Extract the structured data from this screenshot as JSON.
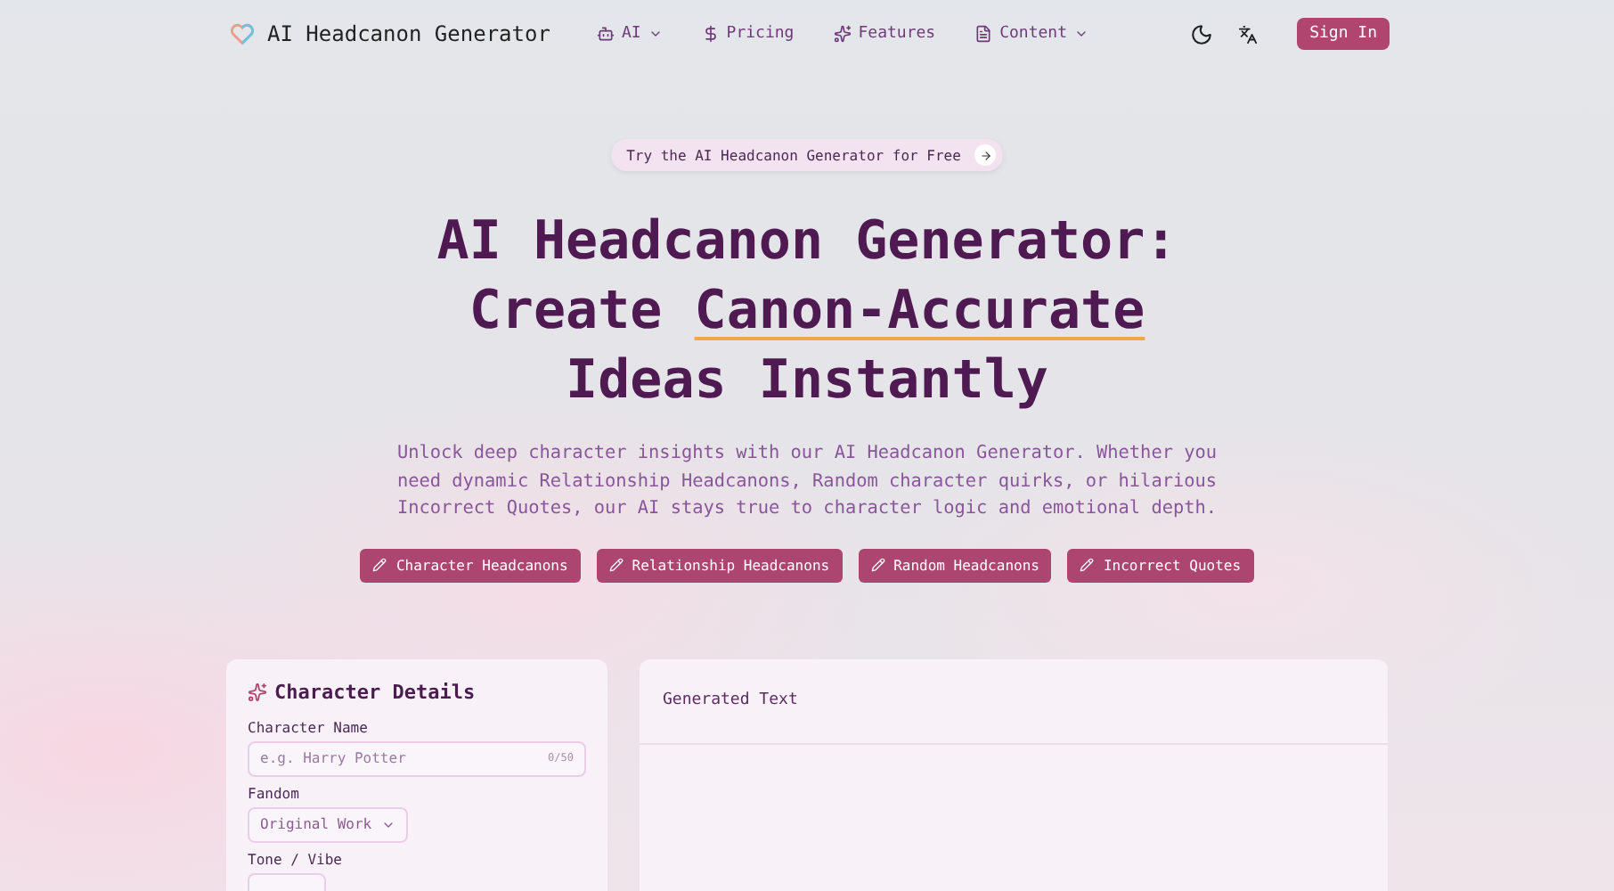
{
  "brand": {
    "name": "AI Headcanon Generator"
  },
  "nav": [
    {
      "label": "AI",
      "kind": "robot",
      "has_menu": true
    },
    {
      "label": "Pricing",
      "kind": "dollar",
      "has_menu": false
    },
    {
      "label": "Features",
      "kind": "sparkles",
      "has_menu": false
    },
    {
      "label": "Content",
      "kind": "document",
      "has_menu": true
    }
  ],
  "actions": {
    "sign_in": "Sign In"
  },
  "promo": {
    "label": "Try the AI Headcanon Generator for Free"
  },
  "headline": {
    "before": "AI Headcanon Generator: Create ",
    "highlight": "Canon-Accurate",
    "after": " Ideas Instantly"
  },
  "description": "Unlock deep character insights with our AI Headcanon Generator. Whether you need dynamic Relationship Headcanons, Random character quirks, or hilarious Incorrect Quotes, our AI stays true to character logic and emotional depth.",
  "modes": [
    "Character Headcanons",
    "Relationship Headcanons",
    "Random Headcanons",
    "Incorrect Quotes"
  ],
  "form": {
    "title": "Character Details",
    "fields": [
      {
        "label": "Character Name",
        "kind": "text",
        "placeholder": "e.g. Harry Potter",
        "counter": "0/50"
      },
      {
        "label": "Fandom",
        "kind": "select",
        "value": "Original Work"
      },
      {
        "label": "Tone / Vibe",
        "kind": "select_cut"
      }
    ]
  },
  "output": {
    "title": "Generated Text"
  }
}
